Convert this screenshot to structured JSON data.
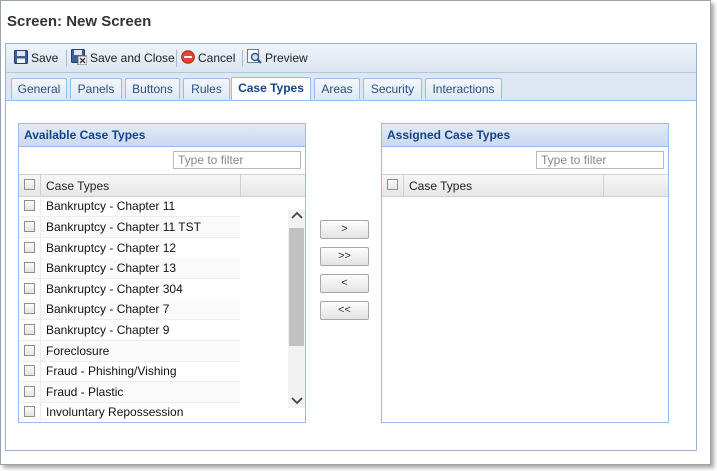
{
  "window": {
    "title": "Screen: New Screen"
  },
  "toolbar": {
    "save_label": "Save",
    "save_close_label": "Save and Close",
    "cancel_label": "Cancel",
    "preview_label": "Preview"
  },
  "tabs": [
    {
      "label": "General",
      "active": false
    },
    {
      "label": "Panels",
      "active": false
    },
    {
      "label": "Buttons",
      "active": false
    },
    {
      "label": "Rules",
      "active": false
    },
    {
      "label": "Case Types",
      "active": true
    },
    {
      "label": "Areas",
      "active": false
    },
    {
      "label": "Security",
      "active": false
    },
    {
      "label": "Interactions",
      "active": false
    }
  ],
  "available": {
    "header": "Available Case Types",
    "filter_placeholder": "Type to filter",
    "column_header": "Case Types",
    "items": [
      "Bankruptcy - Chapter 11",
      "Bankruptcy - Chapter 11 TST",
      "Bankruptcy - Chapter 12",
      "Bankruptcy - Chapter 13",
      "Bankruptcy - Chapter 304",
      "Bankruptcy - Chapter 7",
      "Bankruptcy - Chapter 9",
      "Foreclosure",
      "Fraud - Phishing/Vishing",
      "Fraud - Plastic",
      "Involuntary Repossession"
    ],
    "scroll_position": 0.0
  },
  "move_buttons": {
    "move_one_right": ">",
    "move_all_right": ">>",
    "move_one_left": "<",
    "move_all_left": "<<"
  },
  "assigned": {
    "header": "Assigned Case Types",
    "filter_placeholder": "Type to filter",
    "column_header": "Case Types",
    "items": []
  },
  "colors": {
    "header_text": "#15428b",
    "tab_text": "#2b4f86",
    "border": "#99bbe8",
    "cancel_icon": "#e34234"
  }
}
